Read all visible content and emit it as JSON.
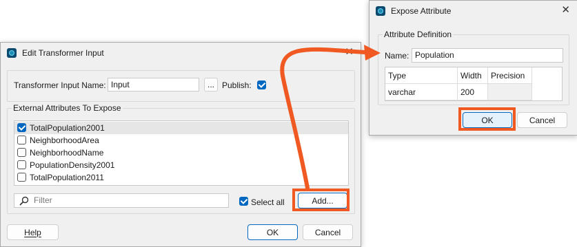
{
  "colors": {
    "accent": "#0067c0",
    "annotation": "#f05a22"
  },
  "edit_dialog": {
    "title": "Edit Transformer Input",
    "name_label": "Transformer Input Name:",
    "name_value": "Input",
    "browse_label": "...",
    "publish_label": "Publish:",
    "publish_checked": true,
    "group_title": "External Attributes To Expose",
    "attributes": [
      {
        "label": "TotalPopulation2001",
        "checked": true
      },
      {
        "label": "NeighborhoodArea",
        "checked": false
      },
      {
        "label": "NeighborhoodName",
        "checked": false
      },
      {
        "label": "PopulationDensity2001",
        "checked": false
      },
      {
        "label": "TotalPopulation2011",
        "checked": false
      }
    ],
    "filter_placeholder": "Filter",
    "select_all_label": "Select all",
    "select_all_checked": true,
    "add_label": "Add...",
    "help_label": "Help",
    "ok_label": "OK",
    "cancel_label": "Cancel"
  },
  "expose_dialog": {
    "title": "Expose Attribute",
    "group_title": "Attribute Definition",
    "name_label": "Name:",
    "name_value": "Population",
    "columns": [
      "Type",
      "Width",
      "Precision"
    ],
    "row": [
      "varchar",
      "200",
      ""
    ],
    "ok_label": "OK",
    "cancel_label": "Cancel"
  }
}
